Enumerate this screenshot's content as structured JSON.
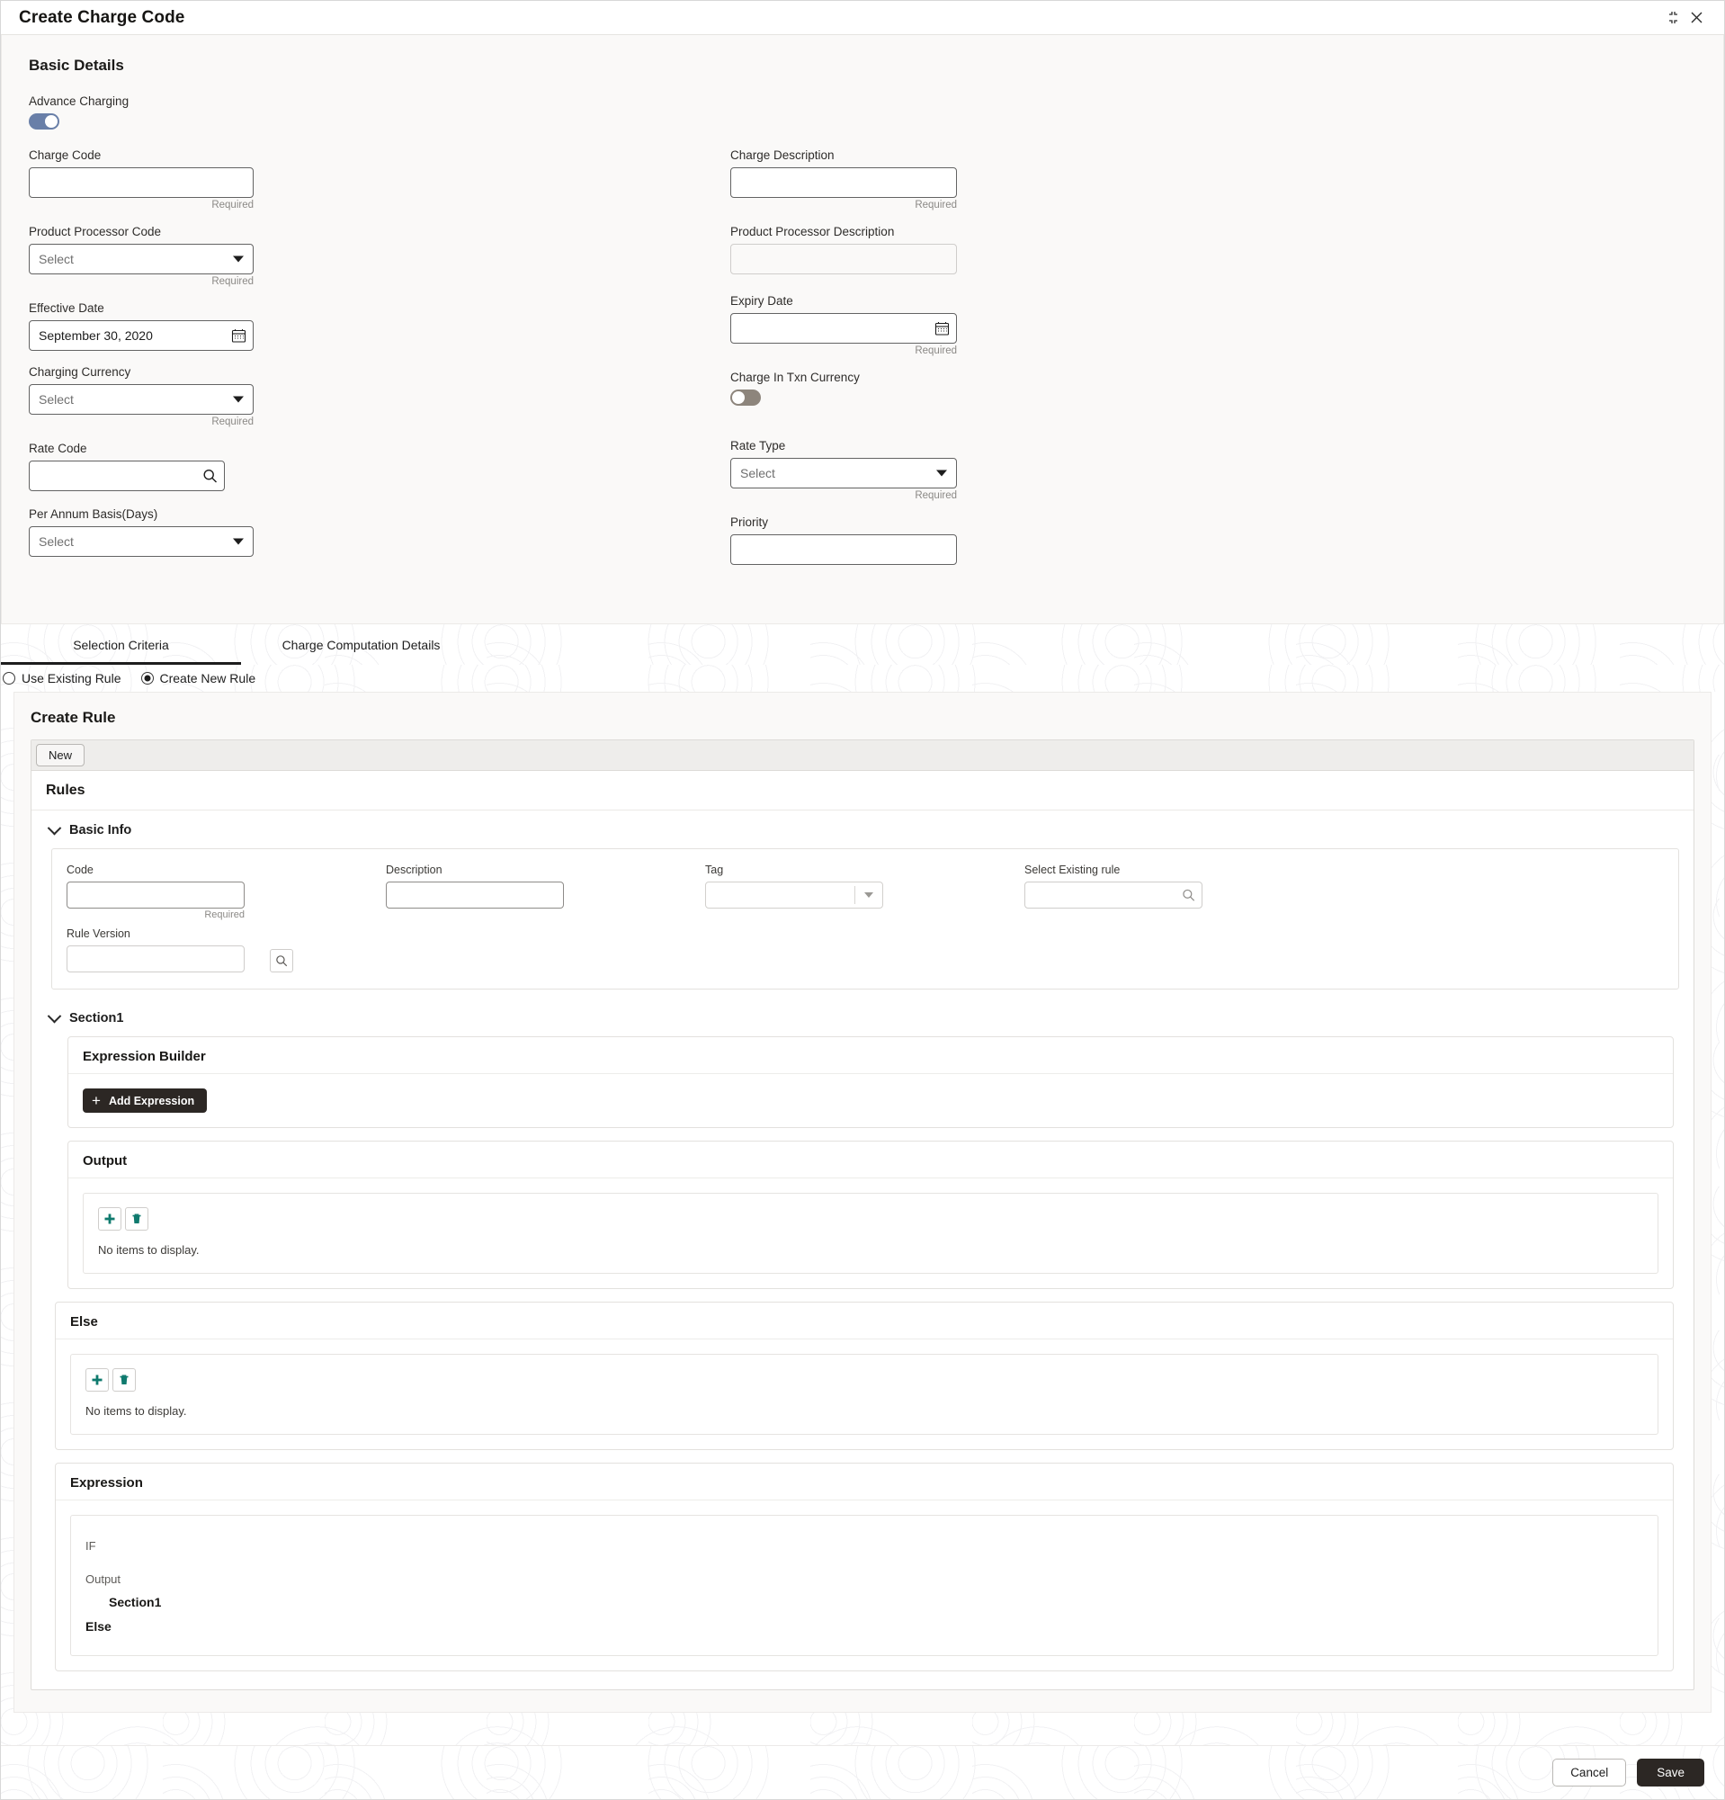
{
  "window": {
    "title": "Create Charge Code",
    "minimize_icon": "collapse-icon",
    "close_icon": "close-icon"
  },
  "basic_details": {
    "heading": "Basic Details",
    "advance_charging": {
      "label": "Advance Charging",
      "state": "on"
    },
    "charge_in_txn_currency": {
      "label": "Charge In Txn Currency",
      "state": "off"
    },
    "required_text": "Required",
    "select_placeholder": "Select",
    "fields": {
      "charge_code": {
        "label": "Charge Code",
        "value": "",
        "required": "Required"
      },
      "charge_description": {
        "label": "Charge Description",
        "value": "",
        "required": "Required"
      },
      "product_processor_code": {
        "label": "Product Processor Code",
        "value": "Select",
        "required": "Required"
      },
      "product_processor_description": {
        "label": "Product Processor Description",
        "value": ""
      },
      "effective_date": {
        "label": "Effective Date",
        "value": "September 30, 2020",
        "icon": "calendar-icon"
      },
      "expiry_date": {
        "label": "Expiry Date",
        "value": "",
        "required": "Required",
        "icon": "calendar-icon"
      },
      "charging_currency": {
        "label": "Charging Currency",
        "value": "Select",
        "required": "Required"
      },
      "rate_code": {
        "label": "Rate Code",
        "value": "",
        "icon": "search-icon"
      },
      "rate_type": {
        "label": "Rate Type",
        "value": "Select",
        "required": "Required"
      },
      "per_annum_basis": {
        "label": "Per Annum Basis(Days)",
        "value": "Select"
      },
      "priority": {
        "label": "Priority",
        "value": ""
      }
    }
  },
  "tabs": [
    {
      "label": "Selection Criteria",
      "active": true
    },
    {
      "label": "Charge Computation Details",
      "active": false
    }
  ],
  "rule_mode": {
    "options": [
      {
        "label": "Use Existing Rule",
        "selected": false
      },
      {
        "label": "Create New Rule",
        "selected": true
      }
    ]
  },
  "create_rule": {
    "heading": "Create Rule",
    "toolbar": {
      "new_label": "New"
    },
    "rules_heading": "Rules",
    "basic_info": {
      "title": "Basic Info",
      "code": {
        "label": "Code",
        "value": "",
        "required": "Required"
      },
      "description": {
        "label": "Description",
        "value": ""
      },
      "tag": {
        "label": "Tag",
        "value": ""
      },
      "select_existing_rule": {
        "label": "Select Existing rule",
        "value": "",
        "icon": "search-icon"
      },
      "rule_version": {
        "label": "Rule Version",
        "value": ""
      },
      "rule_version_search_icon": "search-icon"
    },
    "section1": {
      "title": "Section1",
      "expression_builder": {
        "title": "Expression Builder",
        "add_expression_label": "Add Expression",
        "add_icon": "plus-icon"
      },
      "output": {
        "title": "Output",
        "add_icon": "plus-icon",
        "delete_icon": "trash-icon",
        "empty_text": "No items to display."
      },
      "else": {
        "title": "Else",
        "add_icon": "plus-icon",
        "delete_icon": "trash-icon",
        "empty_text": "No items to display."
      },
      "expression": {
        "title": "Expression",
        "if_text": "IF",
        "output_text": "Output",
        "section_text": "Section1",
        "else_text": "Else"
      }
    }
  },
  "footer": {
    "cancel_label": "Cancel",
    "save_label": "Save"
  },
  "colors": {
    "accent_dark": "#2c2724",
    "toggle_on": "#697fa8",
    "toggle_off": "#8d857c",
    "icon_teal": "#0f7a6e"
  }
}
